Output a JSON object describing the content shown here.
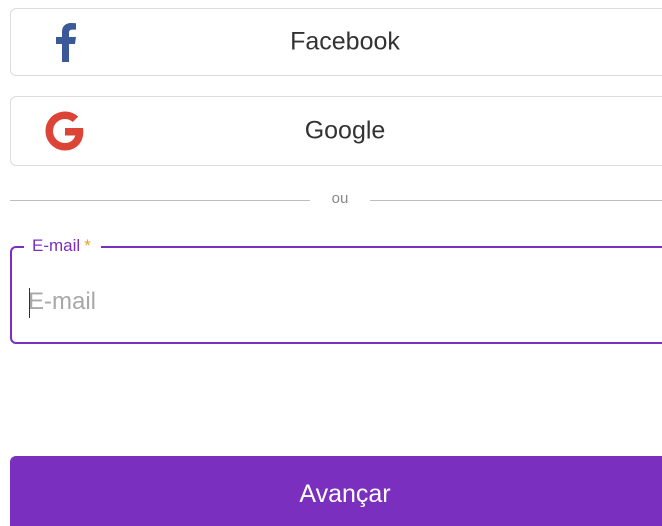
{
  "social_login": {
    "facebook": {
      "label": "Facebook",
      "icon": "facebook-icon",
      "icon_color": "#3b5998"
    },
    "google": {
      "label": "Google",
      "icon": "google-icon",
      "icon_color": "#db4437"
    }
  },
  "divider": {
    "text": "ou"
  },
  "email_field": {
    "legend": "E-mail",
    "required_marker": "*",
    "placeholder": "E-mail",
    "value": ""
  },
  "submit": {
    "label": "Avançar"
  },
  "colors": {
    "accent": "#7b2fbf",
    "required": "#e6a817",
    "border": "#dcdcdc"
  }
}
